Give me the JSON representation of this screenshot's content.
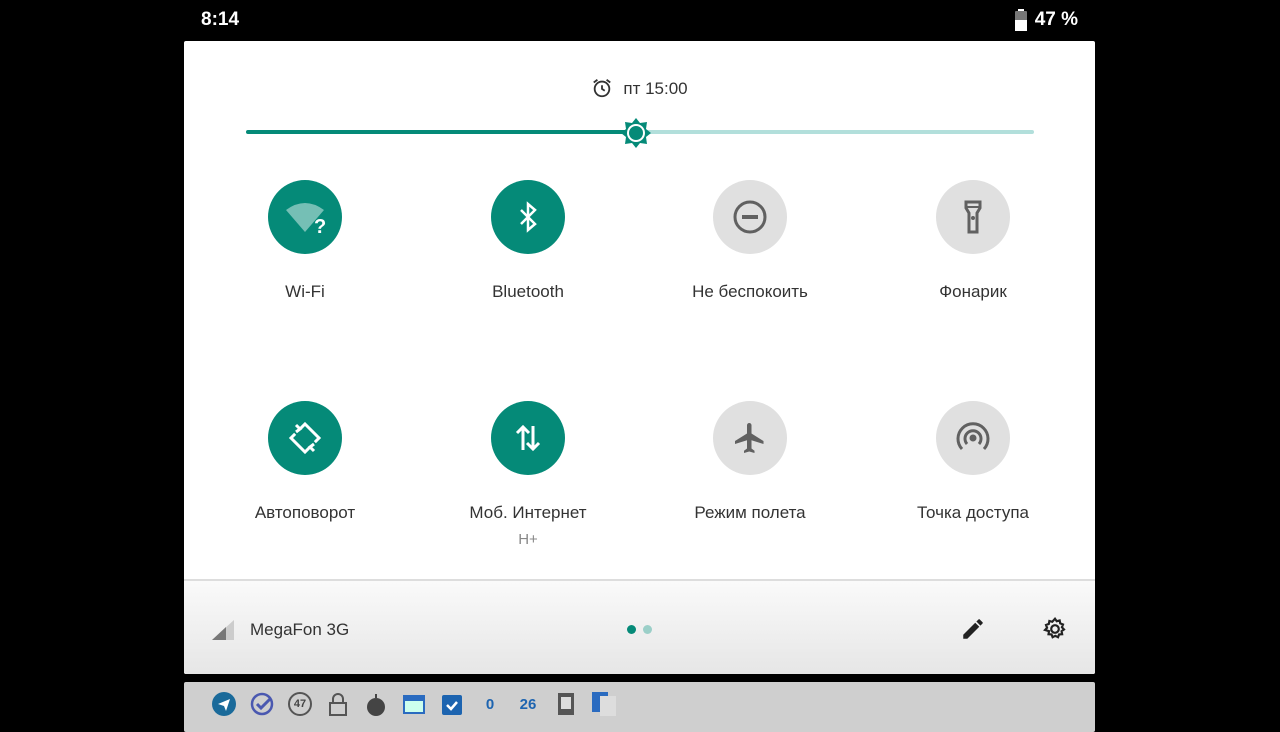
{
  "status_bar": {
    "time": "8:14",
    "battery": "47 %",
    "battery_level": 0.47
  },
  "alarm": {
    "text": "пт 15:00"
  },
  "brightness": {
    "level": 0.5
  },
  "tiles": [
    {
      "label": "Wi-Fi",
      "on": true
    },
    {
      "label": "Bluetooth",
      "on": true
    },
    {
      "label": "Не беспокоить",
      "on": false
    },
    {
      "label": "Фонарик",
      "on": false
    },
    {
      "label": "Автоповорот",
      "on": true
    },
    {
      "label": "Моб. Интернет",
      "sub": "H+",
      "on": true
    },
    {
      "label": "Режим полета",
      "on": false
    },
    {
      "label": "Точка доступа",
      "on": false
    }
  ],
  "footer": {
    "carrier": "MegaFon 3G",
    "page": 1,
    "pages": 2
  },
  "tray": {
    "badge_47": "47",
    "count_0": "0",
    "count_26": "26"
  },
  "colors": {
    "accent": "#058a78",
    "accent_light": "#b2dfdb"
  }
}
